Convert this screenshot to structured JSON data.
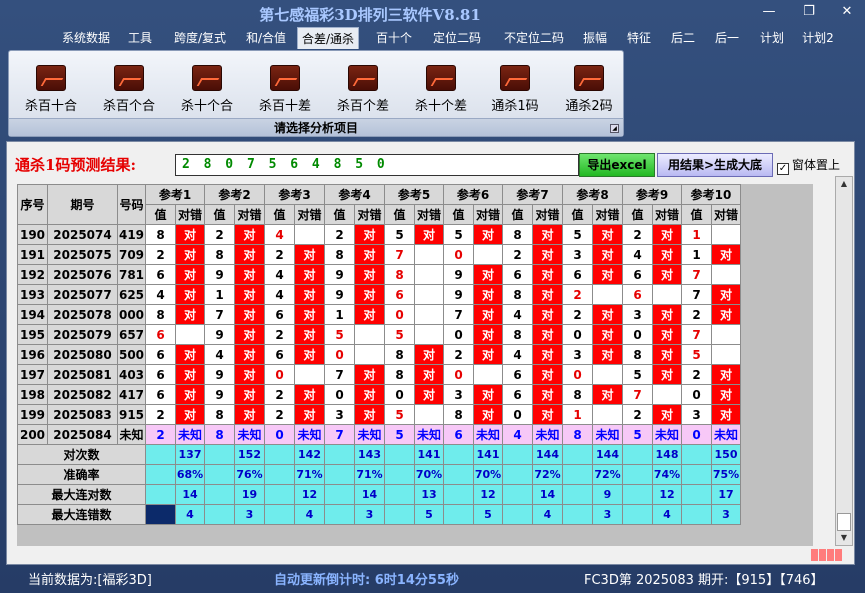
{
  "window": {
    "title": "第七感福彩3D排列三软件V8.81",
    "controls": [
      "—",
      "❐",
      "✕"
    ]
  },
  "menu": [
    "系统数据",
    "工具",
    "跨度/复式",
    "和/合值",
    "合差/通杀",
    "百十个",
    "定位二码",
    "不定位二码",
    "振幅",
    "特征",
    "后二",
    "后一",
    "计划",
    "计划2"
  ],
  "menu_active": "合差/通杀",
  "ribbon": {
    "buttons": [
      "杀百十合",
      "杀百个合",
      "杀十个合",
      "杀百十差",
      "杀百个差",
      "杀十个差",
      "通杀1码",
      "通杀2码"
    ],
    "buttons_icon": "chart-icon",
    "caption": "请选择分析项目"
  },
  "prediction": {
    "label": "通杀1码预测结果:",
    "value": "2 8 0 7 5 6 4 8 5 0",
    "export_button": "导出excel",
    "generate_button": "用结果>生成大底",
    "pin_checkbox": "窗体置上",
    "pin_checked": true
  },
  "table": {
    "headers": {
      "seq": "序号",
      "issue": "期号",
      "code": "号码"
    },
    "refs": [
      "参考1",
      "参考2",
      "参考3",
      "参考4",
      "参考5",
      "参考6",
      "参考7",
      "参考8",
      "参考9",
      "参考10"
    ],
    "sub": {
      "val": "值",
      "result": "对错"
    },
    "mark": "对",
    "rows": [
      {
        "seq": "190",
        "issue": "2025074",
        "code": "419",
        "refs": [
          [
            "8",
            1
          ],
          [
            "2",
            1
          ],
          [
            "4",
            0
          ],
          [
            "2",
            1
          ],
          [
            "5",
            1
          ],
          [
            "5",
            1
          ],
          [
            "8",
            1
          ],
          [
            "5",
            1
          ],
          [
            "2",
            1
          ],
          [
            "1",
            0
          ]
        ]
      },
      {
        "seq": "191",
        "issue": "2025075",
        "code": "709",
        "refs": [
          [
            "2",
            1
          ],
          [
            "8",
            1
          ],
          [
            "2",
            1
          ],
          [
            "8",
            1
          ],
          [
            "7",
            0
          ],
          [
            "0",
            0
          ],
          [
            "2",
            1
          ],
          [
            "3",
            1
          ],
          [
            "4",
            1
          ],
          [
            "1",
            1
          ]
        ]
      },
      {
        "seq": "192",
        "issue": "2025076",
        "code": "781",
        "refs": [
          [
            "6",
            1
          ],
          [
            "9",
            1
          ],
          [
            "4",
            1
          ],
          [
            "9",
            1
          ],
          [
            "8",
            0
          ],
          [
            "9",
            1
          ],
          [
            "6",
            1
          ],
          [
            "6",
            1
          ],
          [
            "6",
            1
          ],
          [
            "7",
            0
          ]
        ]
      },
      {
        "seq": "193",
        "issue": "2025077",
        "code": "625",
        "refs": [
          [
            "4",
            1
          ],
          [
            "1",
            1
          ],
          [
            "4",
            1
          ],
          [
            "9",
            1
          ],
          [
            "6",
            0
          ],
          [
            "9",
            1
          ],
          [
            "8",
            1
          ],
          [
            "2",
            0
          ],
          [
            "6",
            0
          ],
          [
            "7",
            1
          ]
        ]
      },
      {
        "seq": "194",
        "issue": "2025078",
        "code": "000",
        "refs": [
          [
            "8",
            1
          ],
          [
            "7",
            1
          ],
          [
            "6",
            1
          ],
          [
            "1",
            1
          ],
          [
            "0",
            0
          ],
          [
            "7",
            1
          ],
          [
            "4",
            1
          ],
          [
            "2",
            1
          ],
          [
            "3",
            1
          ],
          [
            "2",
            1
          ]
        ]
      },
      {
        "seq": "195",
        "issue": "2025079",
        "code": "657",
        "refs": [
          [
            "6",
            0
          ],
          [
            "9",
            1
          ],
          [
            "2",
            1
          ],
          [
            "5",
            0
          ],
          [
            "5",
            0
          ],
          [
            "0",
            1
          ],
          [
            "8",
            1
          ],
          [
            "0",
            1
          ],
          [
            "0",
            1
          ],
          [
            "7",
            0
          ]
        ]
      },
      {
        "seq": "196",
        "issue": "2025080",
        "code": "500",
        "refs": [
          [
            "6",
            1
          ],
          [
            "4",
            1
          ],
          [
            "6",
            1
          ],
          [
            "0",
            0
          ],
          [
            "8",
            1
          ],
          [
            "2",
            1
          ],
          [
            "4",
            1
          ],
          [
            "3",
            1
          ],
          [
            "8",
            1
          ],
          [
            "5",
            0
          ]
        ]
      },
      {
        "seq": "197",
        "issue": "2025081",
        "code": "403",
        "refs": [
          [
            "6",
            1
          ],
          [
            "9",
            1
          ],
          [
            "0",
            0
          ],
          [
            "7",
            1
          ],
          [
            "8",
            1
          ],
          [
            "0",
            0
          ],
          [
            "6",
            1
          ],
          [
            "0",
            0
          ],
          [
            "5",
            1
          ],
          [
            "2",
            1
          ]
        ]
      },
      {
        "seq": "198",
        "issue": "2025082",
        "code": "417",
        "refs": [
          [
            "6",
            1
          ],
          [
            "9",
            1
          ],
          [
            "2",
            1
          ],
          [
            "0",
            1
          ],
          [
            "0",
            1
          ],
          [
            "3",
            1
          ],
          [
            "6",
            1
          ],
          [
            "8",
            1
          ],
          [
            "7",
            0
          ],
          [
            "0",
            1
          ]
        ]
      },
      {
        "seq": "199",
        "issue": "2025083",
        "code": "915",
        "refs": [
          [
            "2",
            1
          ],
          [
            "8",
            1
          ],
          [
            "2",
            1
          ],
          [
            "3",
            1
          ],
          [
            "5",
            0
          ],
          [
            "8",
            1
          ],
          [
            "0",
            1
          ],
          [
            "1",
            0
          ],
          [
            "2",
            1
          ],
          [
            "3",
            1
          ]
        ]
      }
    ],
    "predict_row": {
      "seq": "200",
      "issue": "2025084",
      "code": "未知",
      "vals": [
        "2",
        "8",
        "0",
        "7",
        "5",
        "6",
        "4",
        "8",
        "5",
        "0"
      ],
      "result": "未知"
    },
    "stats": [
      {
        "label": "对次数",
        "vals": [
          "137",
          "152",
          "142",
          "143",
          "141",
          "141",
          "144",
          "144",
          "148",
          "150"
        ]
      },
      {
        "label": "准确率",
        "vals": [
          "68%",
          "76%",
          "71%",
          "71%",
          "70%",
          "70%",
          "72%",
          "72%",
          "74%",
          "75%"
        ]
      },
      {
        "label": "最大连对数",
        "vals": [
          "14",
          "19",
          "12",
          "14",
          "13",
          "12",
          "14",
          "9",
          "12",
          "17"
        ]
      },
      {
        "label": "最大连错数",
        "vals": [
          "4",
          "3",
          "4",
          "3",
          "5",
          "5",
          "4",
          "3",
          "4",
          "3"
        ]
      }
    ]
  },
  "status": {
    "current_data": "当前数据为:[福彩3D]",
    "countdown": "自动更新倒计时: 6时14分55秒",
    "latest": "FC3D第 2025083 期开:【915】【746】"
  }
}
